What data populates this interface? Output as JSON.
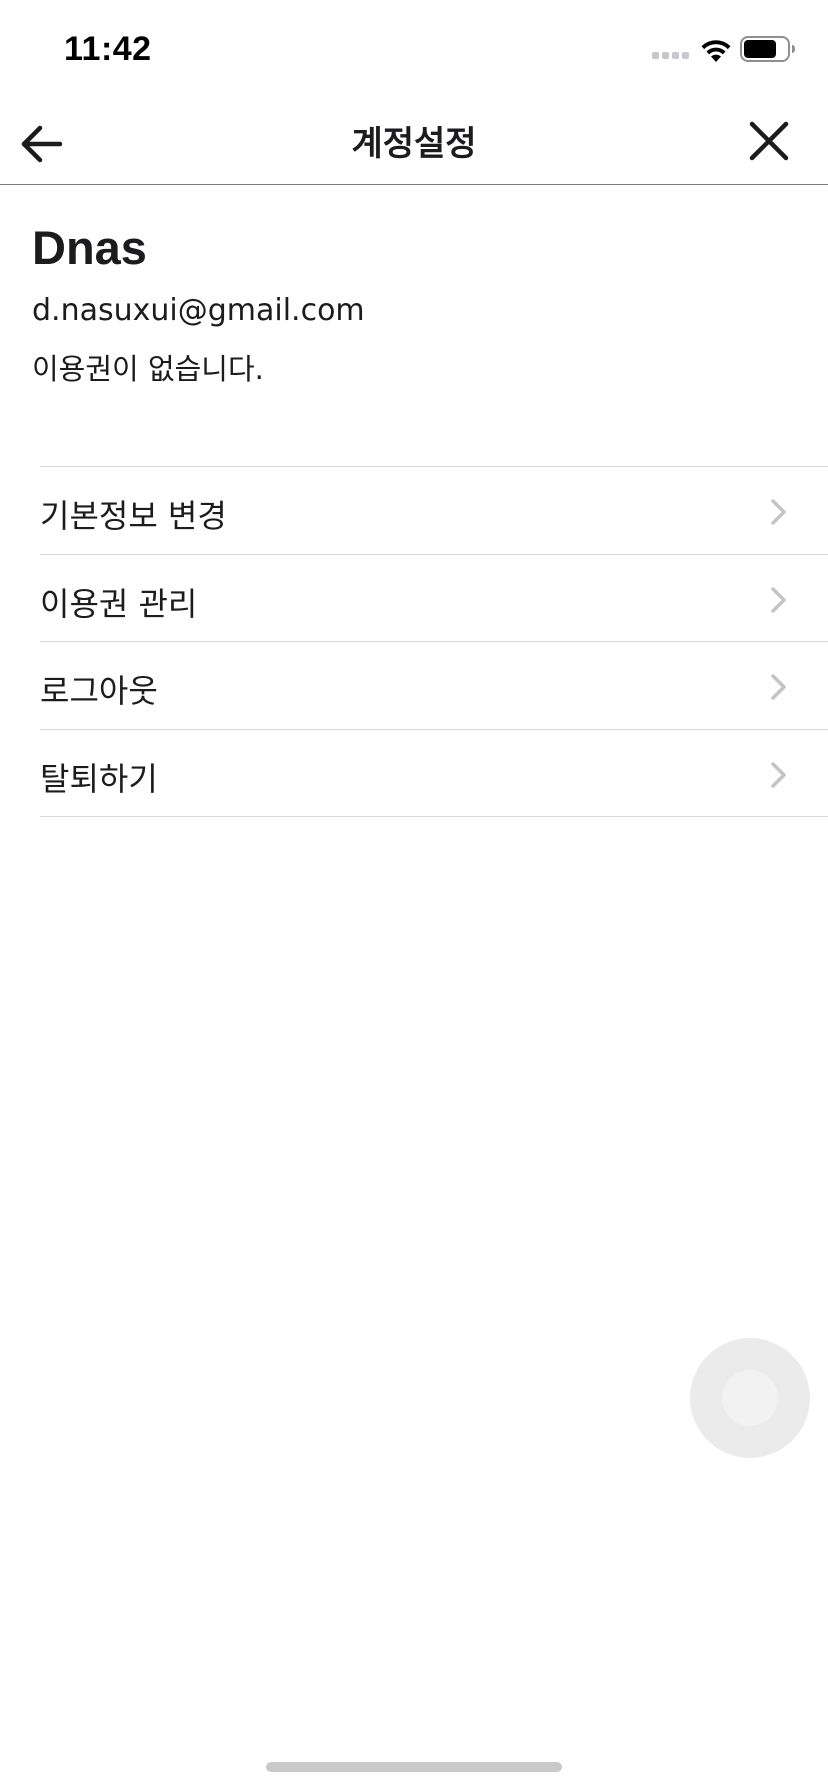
{
  "status_bar": {
    "time": "11:42",
    "signal_icon": "cellular-signal-icon",
    "wifi_icon": "wifi-icon",
    "battery_icon": "battery-icon",
    "battery_level": 0.75
  },
  "nav": {
    "title": "계정설정",
    "back_icon": "arrow-left-icon",
    "close_icon": "close-icon"
  },
  "profile": {
    "name": "Dnas",
    "email": "d.nasuxui@gmail.com",
    "subscription_status": "이용권이 없습니다."
  },
  "menu": {
    "items": [
      {
        "label": "기본정보 변경",
        "icon": "chevron-right-icon"
      },
      {
        "label": "이용권 관리",
        "icon": "chevron-right-icon"
      },
      {
        "label": "로그아웃",
        "icon": "chevron-right-icon"
      },
      {
        "label": "탈퇴하기",
        "icon": "chevron-right-icon"
      }
    ]
  },
  "colors": {
    "text": "#1c1c1e",
    "divider": "#d9d9d9",
    "chevron": "#c4c4c4",
    "nav_border": "#7a7a7a",
    "background": "#ffffff"
  }
}
